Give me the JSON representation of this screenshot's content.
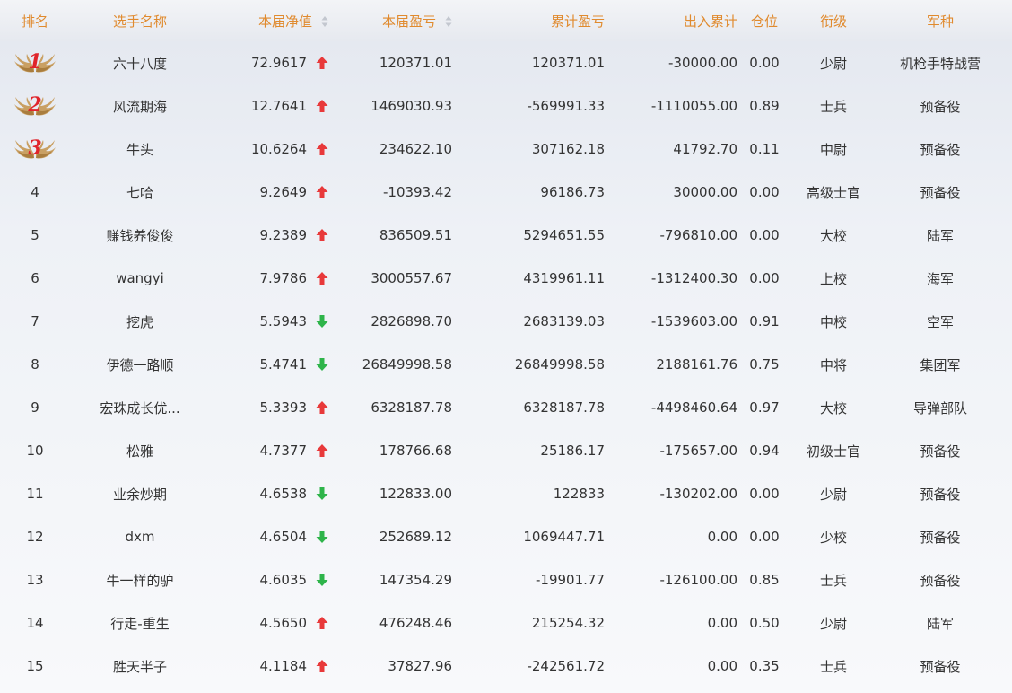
{
  "header": {
    "rank": "排名",
    "name": "选手名称",
    "nav": "本届净值",
    "profit": "本届盈亏",
    "total_profit": "累计盈亏",
    "in_out": "出入累计",
    "position": "仓位",
    "grade": "衔级",
    "branch": "军种"
  },
  "colors": {
    "header_text": "#e08a2e",
    "up": "#e8393a",
    "down": "#2eb44a",
    "medal_number": "#e0242b",
    "medal_wing": "#c9a063"
  },
  "rows": [
    {
      "rank": "1",
      "medal": true,
      "name": "六十八度",
      "nav": "72.9617",
      "trend": "up",
      "profit": "120371.01",
      "total_profit": "120371.01",
      "in_out": "-30000.00",
      "position": "0.00",
      "grade": "少尉",
      "branch": "机枪手特战营"
    },
    {
      "rank": "2",
      "medal": true,
      "name": "风流期海",
      "nav": "12.7641",
      "trend": "up",
      "profit": "1469030.93",
      "total_profit": "-569991.33",
      "in_out": "-1110055.00",
      "position": "0.89",
      "grade": "士兵",
      "branch": "预备役"
    },
    {
      "rank": "3",
      "medal": true,
      "name": "牛头",
      "nav": "10.6264",
      "trend": "up",
      "profit": "234622.10",
      "total_profit": "307162.18",
      "in_out": "41792.70",
      "position": "0.11",
      "grade": "中尉",
      "branch": "预备役"
    },
    {
      "rank": "4",
      "medal": false,
      "name": "七哈",
      "nav": "9.2649",
      "trend": "up",
      "profit": "-10393.42",
      "total_profit": "96186.73",
      "in_out": "30000.00",
      "position": "0.00",
      "grade": "高级士官",
      "branch": "预备役"
    },
    {
      "rank": "5",
      "medal": false,
      "name": "赚钱养俊俊",
      "nav": "9.2389",
      "trend": "up",
      "profit": "836509.51",
      "total_profit": "5294651.55",
      "in_out": "-796810.00",
      "position": "0.00",
      "grade": "大校",
      "branch": "陆军"
    },
    {
      "rank": "6",
      "medal": false,
      "name": "wangyi",
      "nav": "7.9786",
      "trend": "up",
      "profit": "3000557.67",
      "total_profit": "4319961.11",
      "in_out": "-1312400.30",
      "position": "0.00",
      "grade": "上校",
      "branch": "海军"
    },
    {
      "rank": "7",
      "medal": false,
      "name": "挖虎",
      "nav": "5.5943",
      "trend": "down",
      "profit": "2826898.70",
      "total_profit": "2683139.03",
      "in_out": "-1539603.00",
      "position": "0.91",
      "grade": "中校",
      "branch": "空军"
    },
    {
      "rank": "8",
      "medal": false,
      "name": "伊德一路顺",
      "nav": "5.4741",
      "trend": "down",
      "profit": "26849998.58",
      "total_profit": "26849998.58",
      "in_out": "2188161.76",
      "position": "0.75",
      "grade": "中将",
      "branch": "集团军"
    },
    {
      "rank": "9",
      "medal": false,
      "name": "宏珠成长优...",
      "nav": "5.3393",
      "trend": "up",
      "profit": "6328187.78",
      "total_profit": "6328187.78",
      "in_out": "-4498460.64",
      "position": "0.97",
      "grade": "大校",
      "branch": "导弹部队"
    },
    {
      "rank": "10",
      "medal": false,
      "name": "松雅",
      "nav": "4.7377",
      "trend": "up",
      "profit": "178766.68",
      "total_profit": "25186.17",
      "in_out": "-175657.00",
      "position": "0.94",
      "grade": "初级士官",
      "branch": "预备役"
    },
    {
      "rank": "11",
      "medal": false,
      "name": "业余炒期",
      "nav": "4.6538",
      "trend": "down",
      "profit": "122833.00",
      "total_profit": "122833",
      "in_out": "-130202.00",
      "position": "0.00",
      "grade": "少尉",
      "branch": "预备役"
    },
    {
      "rank": "12",
      "medal": false,
      "name": "dxm",
      "nav": "4.6504",
      "trend": "down",
      "profit": "252689.12",
      "total_profit": "1069447.71",
      "in_out": "0.00",
      "position": "0.00",
      "grade": "少校",
      "branch": "预备役"
    },
    {
      "rank": "13",
      "medal": false,
      "name": "牛一样的驴",
      "nav": "4.6035",
      "trend": "down",
      "profit": "147354.29",
      "total_profit": "-19901.77",
      "in_out": "-126100.00",
      "position": "0.85",
      "grade": "士兵",
      "branch": "预备役"
    },
    {
      "rank": "14",
      "medal": false,
      "name": "行走-重生",
      "nav": "4.5650",
      "trend": "up",
      "profit": "476248.46",
      "total_profit": "215254.32",
      "in_out": "0.00",
      "position": "0.50",
      "grade": "少尉",
      "branch": "陆军"
    },
    {
      "rank": "15",
      "medal": false,
      "name": "胜天半子",
      "nav": "4.1184",
      "trend": "up",
      "profit": "37827.96",
      "total_profit": "-242561.72",
      "in_out": "0.00",
      "position": "0.35",
      "grade": "士兵",
      "branch": "预备役"
    }
  ]
}
